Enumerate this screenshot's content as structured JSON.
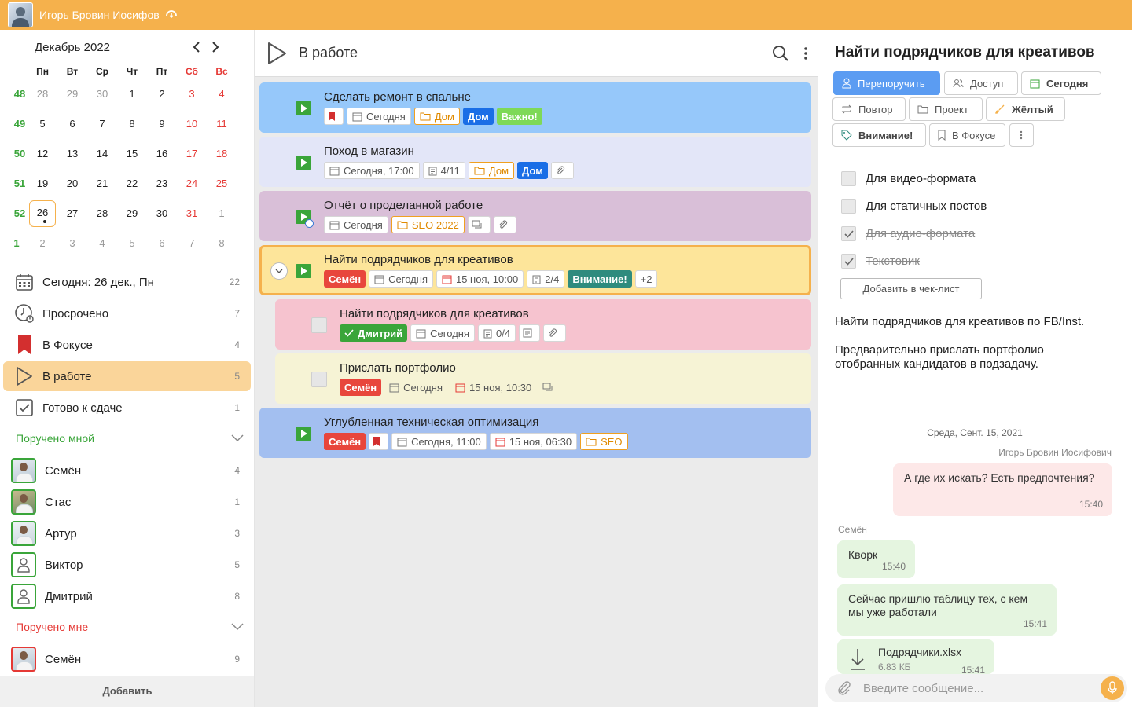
{
  "user": {
    "name": "Игорь Бровин Иосифовi"
  },
  "calendar": {
    "month": "Декабрь 2022",
    "dows": [
      "Пн",
      "Вт",
      "Ср",
      "Чт",
      "Пт",
      "Сб",
      "Вс"
    ],
    "weeks": [
      {
        "num": "48",
        "days": [
          "28",
          "29",
          "30",
          "1",
          "2",
          "3",
          "4"
        ]
      },
      {
        "num": "49",
        "days": [
          "5",
          "6",
          "7",
          "8",
          "9",
          "10",
          "11"
        ]
      },
      {
        "num": "50",
        "days": [
          "12",
          "13",
          "14",
          "15",
          "16",
          "17",
          "18"
        ]
      },
      {
        "num": "51",
        "days": [
          "19",
          "20",
          "21",
          "22",
          "23",
          "24",
          "25"
        ]
      },
      {
        "num": "52",
        "days": [
          "26",
          "27",
          "28",
          "29",
          "30",
          "31",
          "1"
        ]
      },
      {
        "num": "1",
        "days": [
          "2",
          "3",
          "4",
          "5",
          "6",
          "7",
          "8"
        ]
      }
    ]
  },
  "nav": [
    {
      "label": "Сегодня: 26 дек., Пн",
      "count": "22"
    },
    {
      "label": "Просрочено",
      "count": "7"
    },
    {
      "label": "В Фокусе",
      "count": "4"
    },
    {
      "label": "В работе",
      "count": "5"
    },
    {
      "label": "Готово к сдаче",
      "count": "1"
    }
  ],
  "assigned_by_me": {
    "title": "Поручено мной",
    "people": [
      {
        "name": "Семён",
        "count": "4"
      },
      {
        "name": "Стас",
        "count": "1"
      },
      {
        "name": "Артур",
        "count": "3"
      },
      {
        "name": "Виктор",
        "count": "5"
      },
      {
        "name": "Дмитрий",
        "count": "8"
      }
    ]
  },
  "assigned_to_me": {
    "title": "Поручено мне",
    "people": [
      {
        "name": "Семён",
        "count": "9"
      }
    ]
  },
  "add_label": "Добавить",
  "middle": {
    "title": "В работе",
    "tasks": [
      {
        "title": "Сделать ремонт в спальне",
        "tags": {
          "date": "Сегодня",
          "folder": "Дом",
          "label1": "Дом",
          "label2": "Важно!"
        }
      },
      {
        "title": "Поход в магазин",
        "tags": {
          "date": "Сегодня, 17:00",
          "checklist": "4/11",
          "folder": "Дом",
          "label1": "Дом"
        }
      },
      {
        "title": "Отчёт о проделанной работе",
        "tags": {
          "date": "Сегодня",
          "folder": "SEO 2022"
        }
      },
      {
        "title": "Найти подрядчиков для креативов",
        "tags": {
          "person": "Семён",
          "date": "Сегодня",
          "deadline": "15 ноя, 10:00",
          "checklist": "2/4",
          "label1": "Внимание!",
          "more": "+2"
        }
      },
      {
        "title": "Найти подрядчиков для креативов",
        "tags": {
          "person": "Дмитрий",
          "date": "Сегодня",
          "checklist": "0/4"
        }
      },
      {
        "title": "Прислать портфолио",
        "tags": {
          "person": "Семён",
          "date": "Сегодня",
          "deadline": "15 ноя, 10:30"
        }
      },
      {
        "title": "Углубленная техническая оптимизация",
        "tags": {
          "person": "Семён",
          "date": "Сегодня, 11:00",
          "deadline": "15 ноя, 06:30",
          "folder": "SEO"
        }
      }
    ]
  },
  "detail": {
    "title": "Найти подрядчиков для креативов",
    "buttons": [
      "Перепоручить",
      "Доступ",
      "Сегодня",
      "Повтор",
      "Проект",
      "Жёлтый",
      "Внимание!",
      "В Фокусе"
    ],
    "checklist": [
      {
        "label": "Для видео-формата",
        "done": false
      },
      {
        "label": "Для статичных постов",
        "done": false
      },
      {
        "label": "Для аудио-формата",
        "done": true
      },
      {
        "label": "Текстовик",
        "done": true
      }
    ],
    "add_checklist": "Добавить в чек-лист",
    "description1": "Найти подрядчиков для креативов по FB/Inst.",
    "description2": "Предварительно прислать портфолио отобранных кандидатов в подзадачу.",
    "chat": {
      "date": "Среда, Сент. 15, 2021",
      "author_me": "Игорь Бровин Иосифович",
      "msg1": {
        "text": "А где их искать? Есть предпочтения?",
        "time": "15:40"
      },
      "author_other": "Семён",
      "msg2": {
        "text": "Кворк",
        "time": "15:40"
      },
      "msg3": {
        "text": "Сейчас пришлю таблицу тех, с кем мы уже работали",
        "time": "15:41"
      },
      "file": {
        "name": "Подрядчики.xlsx",
        "size": "6.83 КБ",
        "time": "15:41"
      }
    },
    "compose_placeholder": "Введите сообщение..."
  },
  "colors": {
    "accent": "#f5b14c",
    "green": "#3aa53a",
    "red": "#e53935",
    "primary": "#5b9cf2"
  }
}
